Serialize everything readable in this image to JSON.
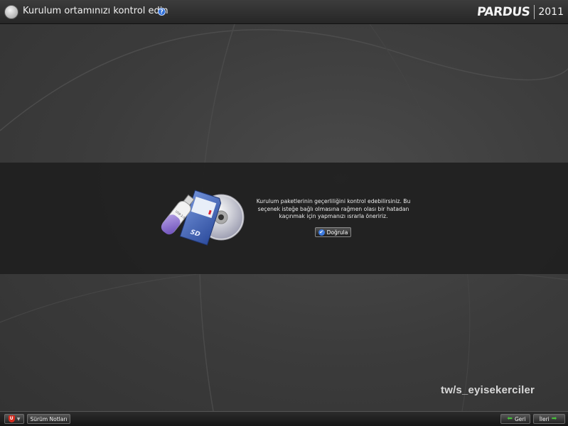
{
  "window": {
    "title": "Kurulum ortamınızı kontrol edin",
    "help_icon": "question-mark-icon",
    "brand_name": "PARDUS",
    "brand_year": "2011"
  },
  "main": {
    "illustration_label": "SD",
    "usb_label": "USB 2.0",
    "message": "Kurulum paketlerinin geçerliliğini kontrol edebilirsiniz. Bu seçenek isteğe bağlı olmasına rağmen olası bir hatadan kaçınmak için yapmanızı ısrarla öneririz.",
    "verify_label": "Doğrula",
    "verify_icon": "check-icon"
  },
  "watermark": "tw/s_eyisekerciler",
  "footer": {
    "menu_icon": "shield-icon",
    "release_notes_label": "Sürüm Notları",
    "back_label": "Geri",
    "next_label": "İleri"
  },
  "colors": {
    "background": "#3a3a3a",
    "band": "#202020",
    "accent_blue": "#3d7be0",
    "arrow_green": "#47c23b",
    "shield_red": "#d62a1d"
  }
}
